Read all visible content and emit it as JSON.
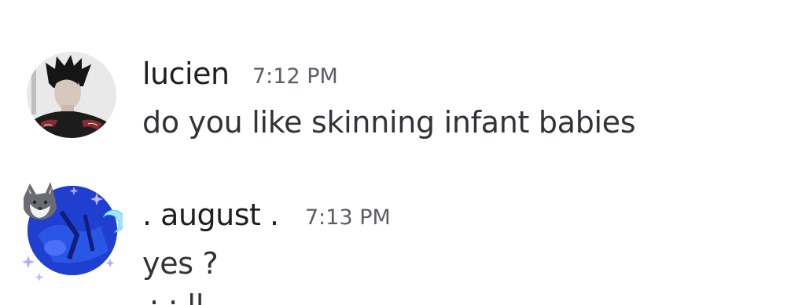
{
  "messages": [
    {
      "username": "lucien",
      "timestamp": "7:12 PM",
      "text": "do you like skinning infant babies",
      "avatar_icon": "user-avatar-dark-hair"
    },
    {
      "username": ". august .",
      "timestamp": "7:13 PM",
      "text": "yes  ?",
      "avatar_icon": "user-avatar-blue-decorated"
    }
  ],
  "colors": {
    "background": "#ffffff",
    "username": "#1e1f22",
    "timestamp": "#5c5e66",
    "message_text": "#313338",
    "avatar_blue": "#1f3fd0"
  }
}
